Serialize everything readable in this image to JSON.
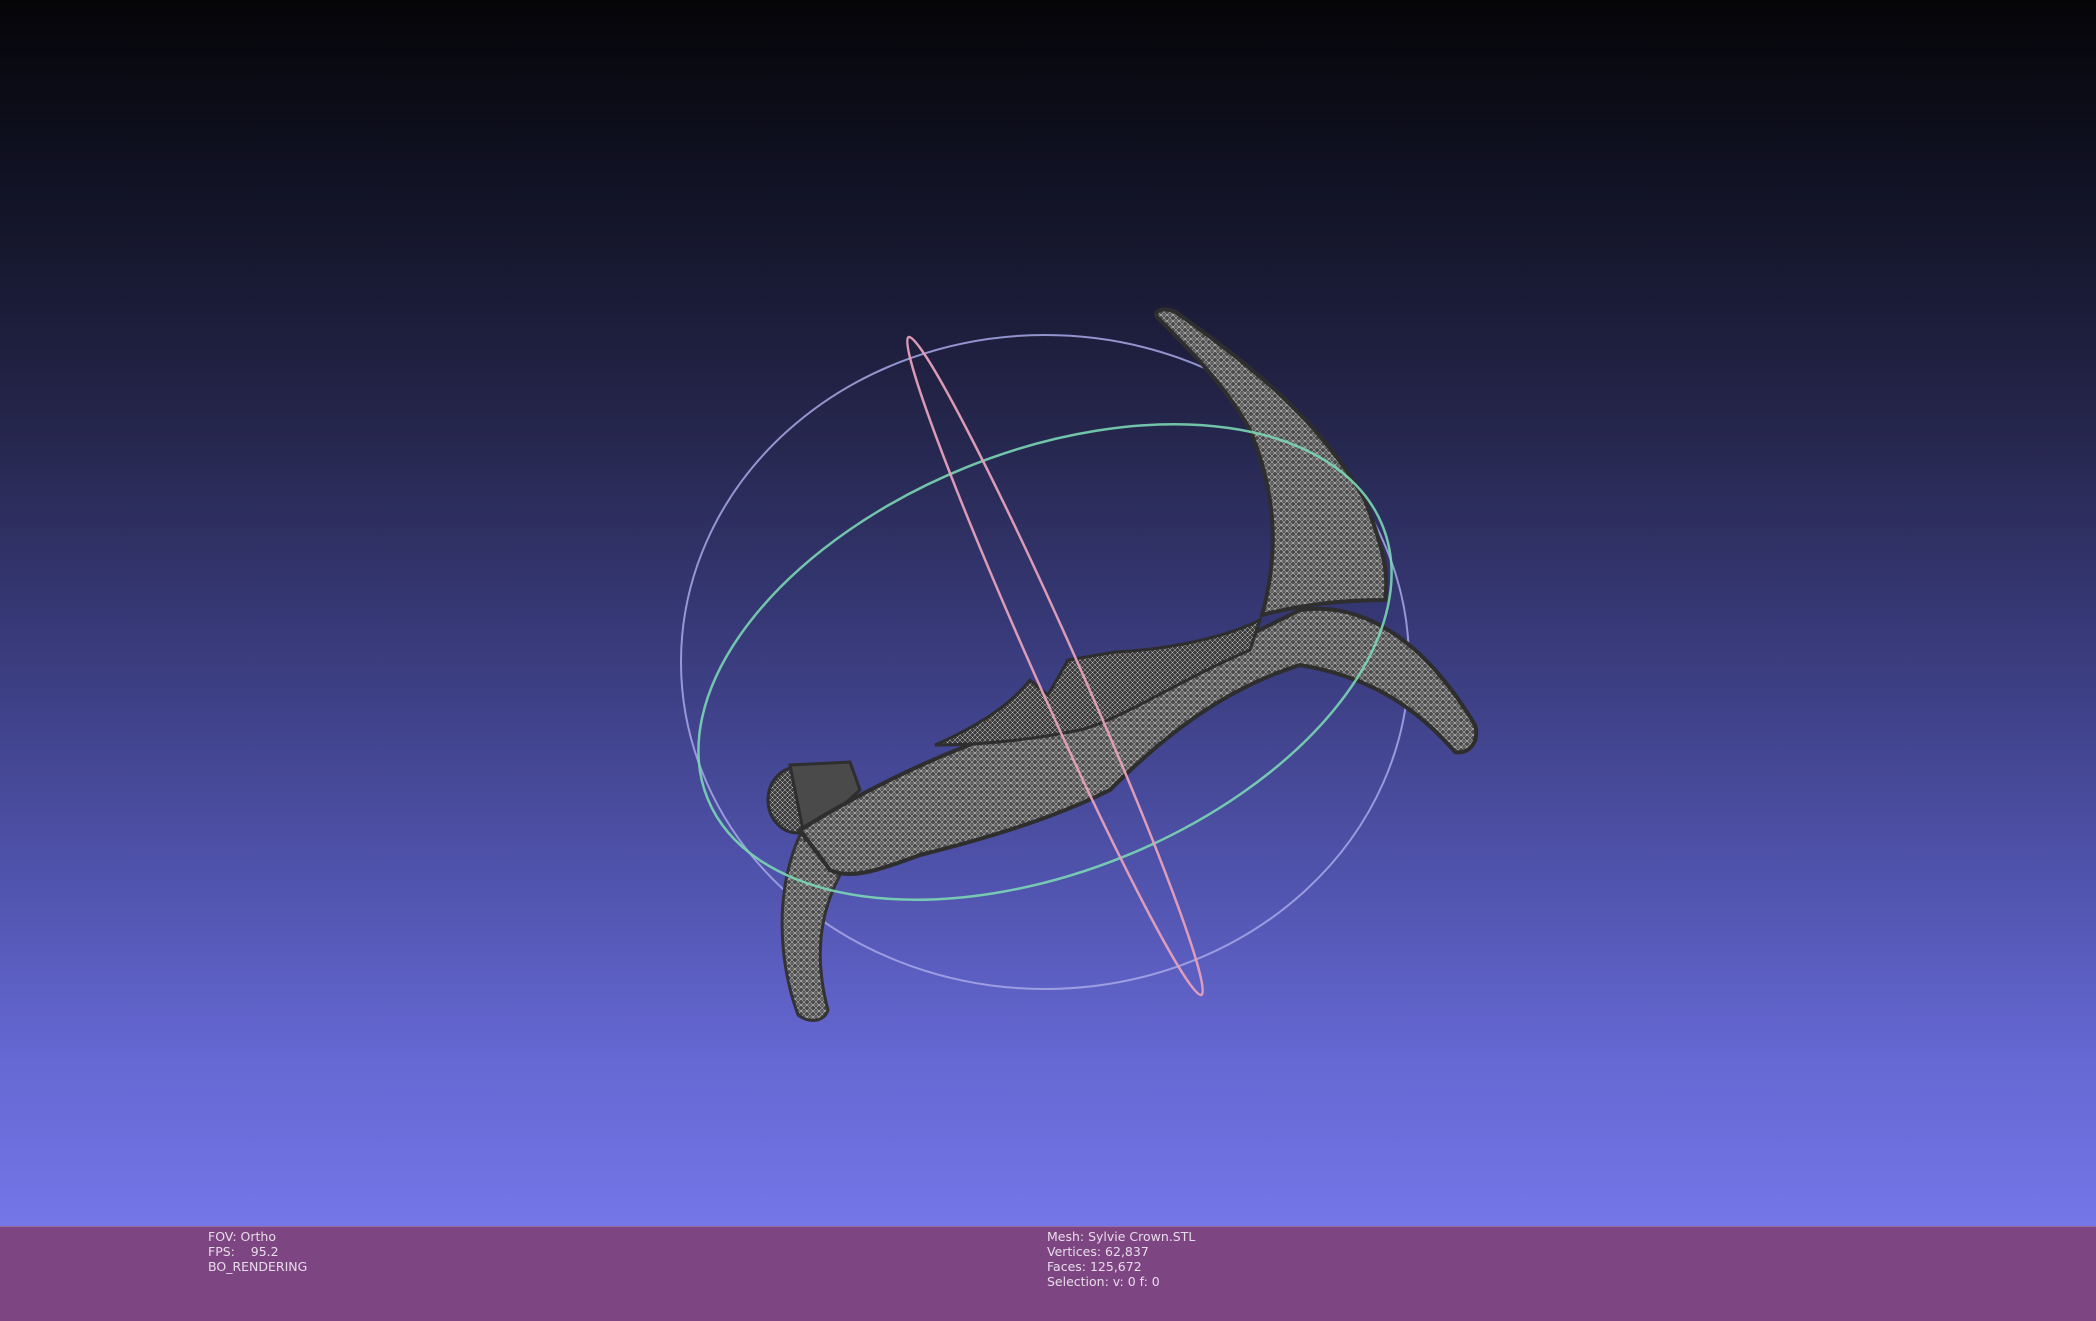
{
  "viewport": {
    "background_top": "#050508",
    "background_bottom": "#7476e8",
    "mesh_color": "#4a4a4a",
    "wire_color": "#b8b8b8",
    "trackball_colors": {
      "horizontal": "#7ad6b4",
      "vertical": "#e6a0bc",
      "depth": "#a8a8e8"
    }
  },
  "info_bar": {
    "color": "#7d4683",
    "left": {
      "fov": "FOV: Ortho",
      "fps_label": "FPS:",
      "fps_value": "95.2",
      "render_mode": "BO_RENDERING"
    },
    "right": {
      "mesh": "Mesh: Sylvie Crown.STL",
      "vertices": "Vertices: 62,837",
      "faces": "Faces: 125,672",
      "selection": "Selection: v: 0 f: 0"
    }
  }
}
